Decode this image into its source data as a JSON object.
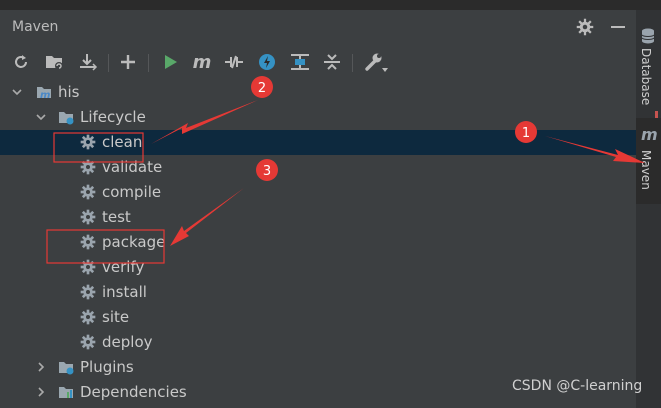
{
  "panel": {
    "title": "Maven"
  },
  "sidebar": {
    "database_label": "Database",
    "maven_label": "Maven"
  },
  "tree": {
    "root": "his",
    "lifecycle": "Lifecycle",
    "goals": [
      "clean",
      "validate",
      "compile",
      "test",
      "package",
      "verify",
      "install",
      "site",
      "deploy"
    ],
    "plugins": "Plugins",
    "dependencies": "Dependencies"
  },
  "annotations": {
    "marker_1": "1",
    "marker_2": "2",
    "marker_3": "3"
  },
  "watermark": "CSDN @C-learning",
  "colors": {
    "accent_red": "#e53935",
    "selection": "#0d293e",
    "run_green": "#59a869",
    "gear_gray": "#9aa4ad"
  },
  "icons": [
    "refresh-icon",
    "add-folder-icon",
    "download-icon",
    "plus-icon",
    "run-icon",
    "maven-m-icon",
    "toggle-offline-icon",
    "thread-icon",
    "show-dependencies-icon",
    "collapse-icon",
    "settings-wrench-icon"
  ]
}
